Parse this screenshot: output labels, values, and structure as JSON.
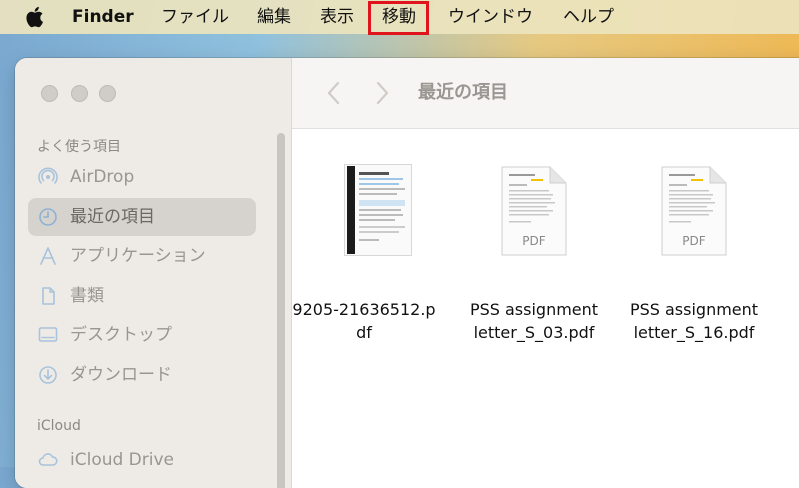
{
  "menubar": {
    "apple_icon": "apple-logo-icon",
    "items": [
      {
        "label": "Finder",
        "bold": true
      },
      {
        "label": "ファイル"
      },
      {
        "label": "編集"
      },
      {
        "label": "表示"
      },
      {
        "label": "移動",
        "highlighted": true
      },
      {
        "label": "ウインドウ"
      },
      {
        "label": "ヘルプ"
      }
    ],
    "highlight_color": "#e0141c"
  },
  "sidebar": {
    "section_favorites": "よく使う項目",
    "items": [
      {
        "label": "AirDrop",
        "icon": "airdrop-icon"
      },
      {
        "label": "最近の項目",
        "icon": "clock-icon",
        "selected": true
      },
      {
        "label": "アプリケーション",
        "icon": "applications-icon"
      },
      {
        "label": "書類",
        "icon": "document-icon"
      },
      {
        "label": "デスクトップ",
        "icon": "desktop-icon"
      },
      {
        "label": "ダウンロード",
        "icon": "download-icon"
      }
    ],
    "section_icloud": "iCloud",
    "icloud_items": [
      {
        "label": "iCloud Drive",
        "icon": "cloud-icon"
      }
    ]
  },
  "toolbar": {
    "title": "最近の項目",
    "back_icon": "chevron-left-icon",
    "forward_icon": "chevron-right-icon"
  },
  "files": [
    {
      "name_line1": "9205-21636512.p",
      "name_line2": "df",
      "thumb_label": ""
    },
    {
      "name_line1": "PSS assignment",
      "name_line2": "letter_S_03.pdf",
      "thumb_label": "PDF"
    },
    {
      "name_line1": "PSS assignment",
      "name_line2": "letter_S_16.pdf",
      "thumb_label": "PDF"
    }
  ]
}
